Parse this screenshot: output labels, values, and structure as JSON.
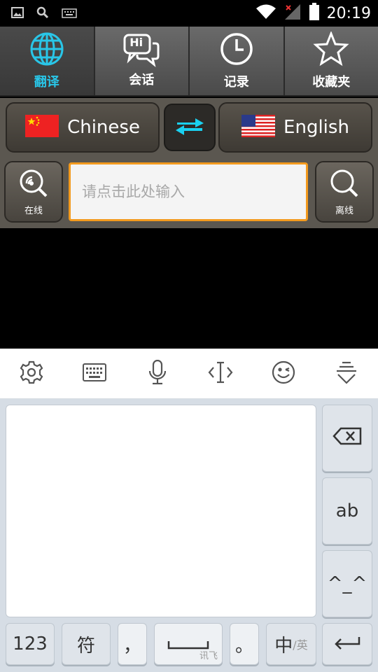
{
  "status_bar": {
    "time": "20:19"
  },
  "tabs": [
    {
      "label": "翻译",
      "icon": "globe-icon",
      "active": true
    },
    {
      "label": "会话",
      "icon": "chat-hi-icon",
      "icon_text": "Hi",
      "active": false
    },
    {
      "label": "记录",
      "icon": "clock-icon",
      "active": false
    },
    {
      "label": "收藏夹",
      "icon": "star-icon",
      "active": false
    }
  ],
  "languages": {
    "source": {
      "name": "Chinese",
      "flag": "china-flag-icon"
    },
    "target": {
      "name": "English",
      "flag": "us-flag-icon"
    }
  },
  "input": {
    "placeholder": "请点击此处输入",
    "value": ""
  },
  "online_button": {
    "label": "在线"
  },
  "offline_button": {
    "label": "离线"
  },
  "keyboard": {
    "keys": {
      "ab": "ab",
      "emoticon": "^_^",
      "num": "123",
      "symbols": "符",
      "comma": "，",
      "space_brand": "讯飞",
      "period": "。",
      "lang_main": "中",
      "lang_alt": "/英"
    }
  },
  "colors": {
    "accent": "#29c6e8",
    "input_border": "#f39a1e",
    "swap_arrow": "#1ad0f0"
  }
}
